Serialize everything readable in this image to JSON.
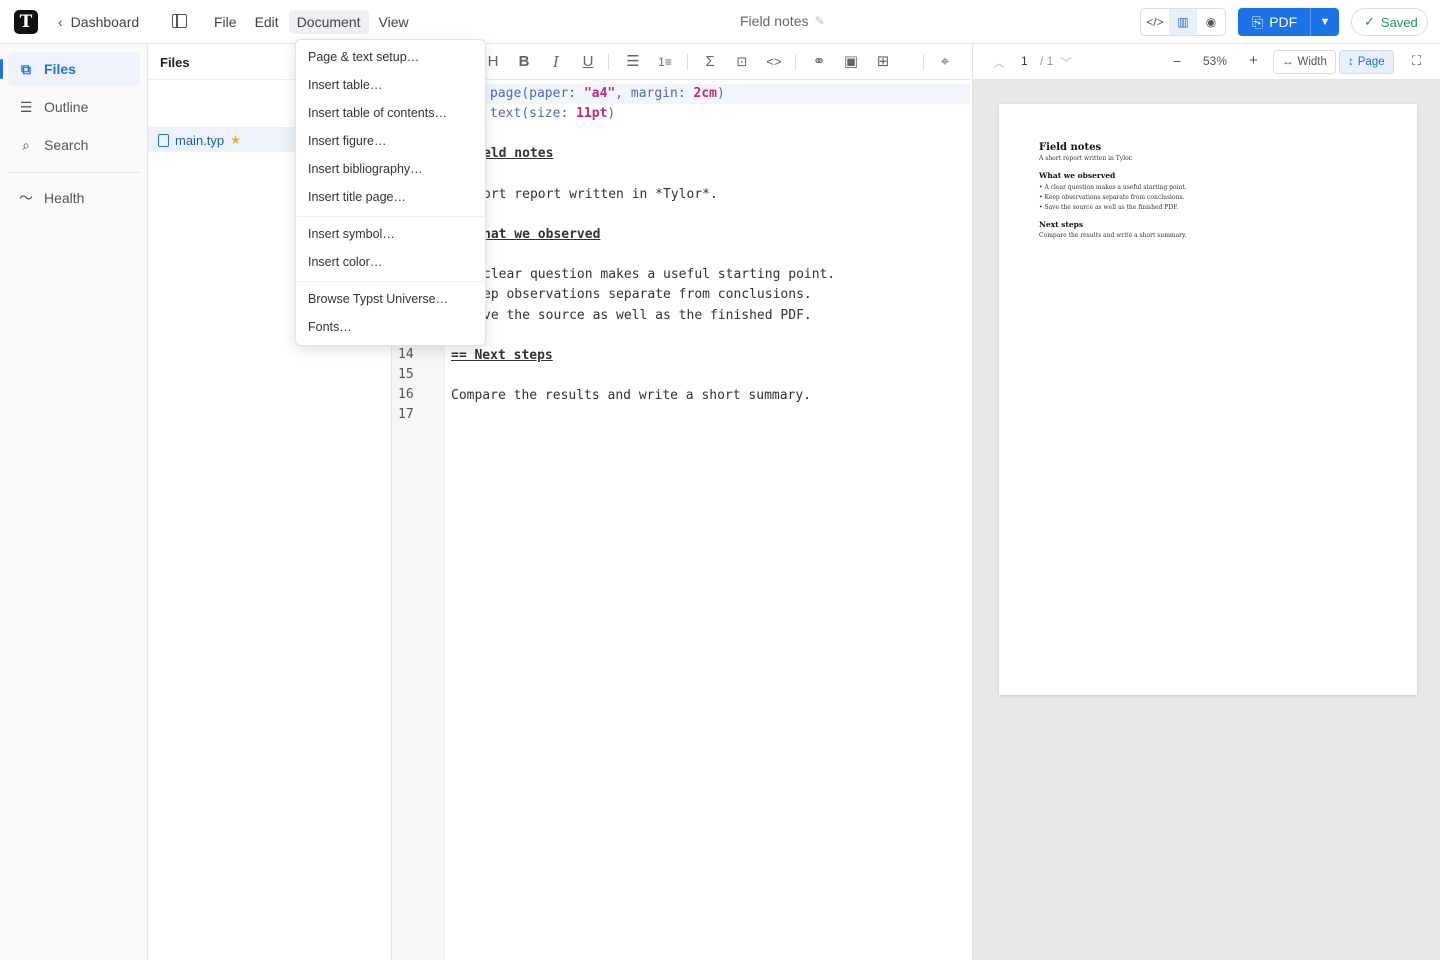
{
  "app": {
    "logo_letter": "T"
  },
  "header": {
    "back_label": "Dashboard",
    "menus": [
      "File",
      "Edit",
      "Document",
      "View"
    ],
    "active_menu": "Document",
    "doc_title": "Field notes",
    "export_label": "PDF",
    "saved_label": "Saved",
    "view_modes": [
      "code",
      "split",
      "preview"
    ],
    "active_view": "split"
  },
  "sidebar": {
    "items": [
      {
        "label": "Files",
        "icon": "files-icon",
        "active": true
      },
      {
        "label": "Outline",
        "icon": "list-icon",
        "active": false
      },
      {
        "label": "Search",
        "icon": "search-icon",
        "active": false
      },
      {
        "label": "Health",
        "icon": "activity-icon",
        "active": false
      }
    ]
  },
  "files_panel": {
    "title": "Files",
    "files": [
      {
        "name": "main.typ",
        "starred": true
      }
    ]
  },
  "document_menu": {
    "groups": [
      [
        "Page & text setup…",
        "Insert table…",
        "Insert table of contents…",
        "Insert figure…",
        "Insert bibliography…",
        "Insert title page…"
      ],
      [
        "Insert symbol…",
        "Insert color…"
      ],
      [
        "Browse Typst Universe…",
        "Fonts…"
      ]
    ]
  },
  "editor": {
    "toolbar": [
      "heading-icon",
      "bold-icon",
      "italic-icon",
      "underline-icon",
      "bullet-list-icon",
      "numbered-list-icon",
      "sum-icon",
      "math-block-icon",
      "code-icon",
      "link-icon",
      "image-icon",
      "table-icon",
      "target-icon"
    ],
    "line_numbers": [
      "14",
      "15",
      "16",
      "17"
    ],
    "visible_lines": {
      "l1_a": "page",
      "l1_b": "(paper: ",
      "l1_c": "\"a4\"",
      "l1_d": ", margin: ",
      "l1_e": "2cm",
      "l1_f": ")",
      "l2_a": "text",
      "l2_b": "(size: ",
      "l2_c": "11pt",
      "l2_d": ")",
      "l4": "eld notes",
      "l6": "ort report written in *Tylor*.",
      "l8": "hat we observed",
      "l10": "clear question makes a useful starting point.",
      "l11": "ep observations separate from conclusions.",
      "l12": "ve the source as well as the finished PDF.",
      "l14": "== Next steps",
      "l16": "Compare the results and write a short summary."
    }
  },
  "preview": {
    "page_current": "1",
    "page_total": "/ 1",
    "zoom": "53%",
    "fit_width_label": "Width",
    "fit_page_label": "Page",
    "content": {
      "title": "Field notes",
      "subtitle": "A short report written in Tylor.",
      "h1": "What we observed",
      "bullets": [
        "A clear question makes a useful starting point.",
        "Keep observations separate from conclusions.",
        "Save the source as well as the finished PDF."
      ],
      "h2": "Next steps",
      "p": "Compare the results and write a short summary."
    }
  }
}
